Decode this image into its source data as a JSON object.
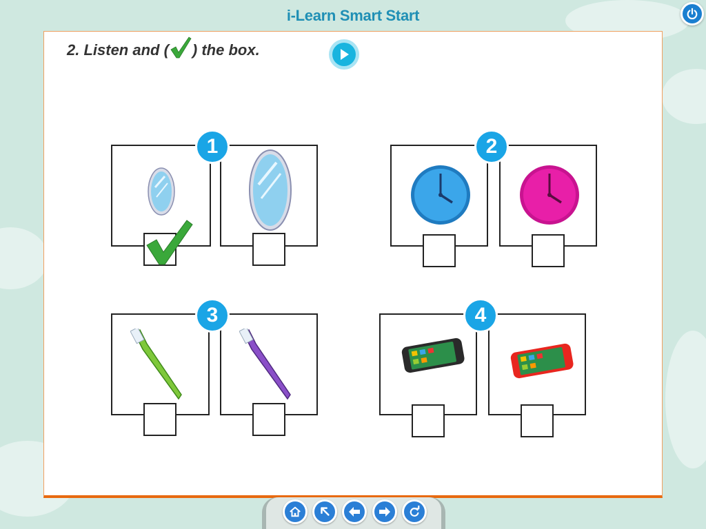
{
  "app": {
    "title": "i-Learn Smart Start"
  },
  "exercise": {
    "instruction_before": "2. Listen and (",
    "instruction_after": ") the box."
  },
  "questions": [
    {
      "number": "1",
      "options": [
        {
          "item": "small-mirror",
          "checked": true
        },
        {
          "item": "big-mirror",
          "checked": false
        }
      ]
    },
    {
      "number": "2",
      "options": [
        {
          "item": "blue-clock",
          "checked": false
        },
        {
          "item": "pink-clock",
          "checked": false
        }
      ]
    },
    {
      "number": "3",
      "options": [
        {
          "item": "green-toothbrush",
          "checked": false
        },
        {
          "item": "purple-toothbrush",
          "checked": false
        }
      ]
    },
    {
      "number": "4",
      "options": [
        {
          "item": "black-phone",
          "checked": false
        },
        {
          "item": "red-phone",
          "checked": false
        }
      ]
    }
  ],
  "nav": {
    "buttons": [
      "home-icon",
      "back-to-menu-icon",
      "previous-icon",
      "next-icon",
      "replay-icon"
    ]
  },
  "colors": {
    "accent": "#1aa5e6",
    "title": "#1f8fb5",
    "check": "#3aa83a",
    "page_border": "#e86a10"
  }
}
